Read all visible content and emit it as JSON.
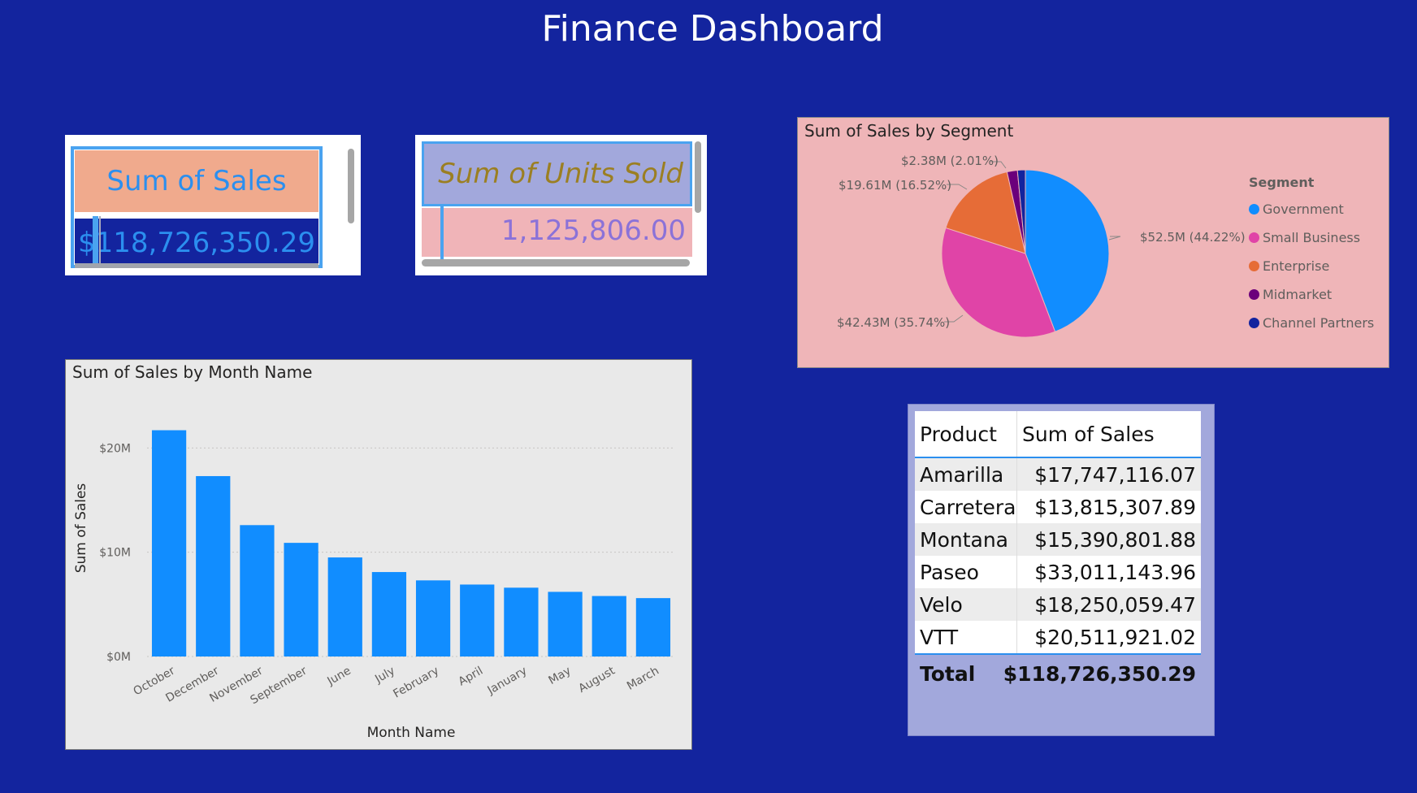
{
  "dashboard_title": "Finance Dashboard",
  "kpi_sales": {
    "label": "Sum of Sales",
    "value": "$118,726,350.29"
  },
  "kpi_units": {
    "label": "Sum of Units Sold",
    "value": "1,125,806.00"
  },
  "pie": {
    "title": "Sum of Sales by Segment",
    "legend_title": "Segment",
    "legend": [
      "Government",
      "Small Business",
      "Enterprise",
      "Midmarket",
      "Channel Partners"
    ],
    "data_labels": {
      "government": "$52.5M (44.22%)",
      "small_business": "$42.43M (35.74%)",
      "enterprise": "$19.61M (16.52%)",
      "midmarket": "$2.38M (2.01%)"
    }
  },
  "bar": {
    "title": "Sum of Sales by Month Name",
    "xlabel": "Month Name",
    "ylabel": "Sum of Sales",
    "yticks": [
      "$0M",
      "$10M",
      "$20M"
    ]
  },
  "table": {
    "headers": [
      "Product",
      "Sum of Sales"
    ],
    "rows": [
      [
        "Amarilla",
        "$17,747,116.07"
      ],
      [
        "Carretera",
        "$13,815,307.89"
      ],
      [
        "Montana",
        "$15,390,801.88"
      ],
      [
        "Paseo",
        "$33,011,143.96"
      ],
      [
        "Velo",
        "$18,250,059.47"
      ],
      [
        "VTT",
        "$20,511,921.02"
      ]
    ],
    "total_label": "Total",
    "total_value": "$118,726,350.29"
  },
  "colors": {
    "background": "#13249e",
    "bar": "#118dff",
    "government": "#118dff",
    "small_business": "#e044a7",
    "enterprise": "#e66c37",
    "midmarket": "#6b007b",
    "channel_partners": "#12239e"
  },
  "chart_data": [
    {
      "type": "pie",
      "title": "Sum of Sales by Segment",
      "series": [
        {
          "name": "Government",
          "value": 52.5
        },
        {
          "name": "Small Business",
          "value": 42.43
        },
        {
          "name": "Enterprise",
          "value": 19.61
        },
        {
          "name": "Midmarket",
          "value": 2.38
        },
        {
          "name": "Channel Partners",
          "value": 1.81
        }
      ],
      "unit": "$M"
    },
    {
      "type": "bar",
      "title": "Sum of Sales by Month Name",
      "categories": [
        "October",
        "December",
        "November",
        "September",
        "June",
        "July",
        "February",
        "April",
        "January",
        "May",
        "August",
        "March"
      ],
      "values": [
        21.7,
        17.3,
        12.6,
        10.9,
        9.5,
        8.1,
        7.3,
        6.9,
        6.6,
        6.2,
        5.8,
        5.6
      ],
      "xlabel": "Month Name",
      "ylabel": "Sum of Sales",
      "ylim": [
        0,
        24
      ],
      "unit": "$M",
      "grid": true
    }
  ]
}
